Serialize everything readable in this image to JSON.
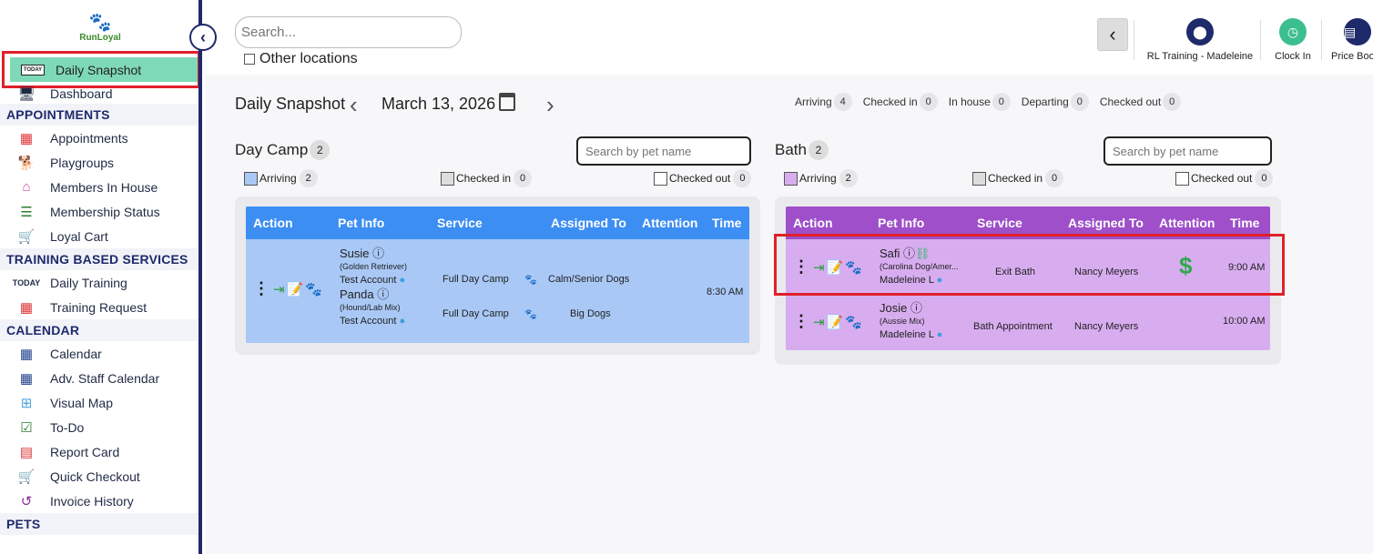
{
  "brand": {
    "name": "RunLoyal"
  },
  "sidebar": {
    "active": {
      "label": "Daily Snapshot",
      "icon": "today-icon",
      "icon_text": "TODAY"
    },
    "top_items": [
      {
        "label": "Dashboard",
        "icon": "dashboard-icon"
      }
    ],
    "sections": [
      {
        "title": "APPOINTMENTS",
        "items": [
          {
            "label": "Appointments",
            "icon": "appointments-calendar-icon"
          },
          {
            "label": "Playgroups",
            "icon": "playgroups-dog-icon"
          },
          {
            "label": "Members In House",
            "icon": "house-icon"
          },
          {
            "label": "Membership Status",
            "icon": "membership-status-icon"
          },
          {
            "label": "Loyal Cart",
            "icon": "cart-icon"
          }
        ]
      },
      {
        "title": "TRAINING BASED SERVICES",
        "items": [
          {
            "label": "Daily Training",
            "icon": "today-training-icon"
          },
          {
            "label": "Training Request",
            "icon": "training-request-icon"
          }
        ]
      },
      {
        "title": "CALENDAR",
        "items": [
          {
            "label": "Calendar",
            "icon": "calendar-icon"
          },
          {
            "label": "Adv. Staff Calendar",
            "icon": "staff-calendar-icon"
          },
          {
            "label": "Visual Map",
            "icon": "visual-map-icon"
          },
          {
            "label": "To-Do",
            "icon": "todo-icon"
          },
          {
            "label": "Report Card",
            "icon": "report-card-icon"
          },
          {
            "label": "Quick Checkout",
            "icon": "quick-checkout-icon"
          },
          {
            "label": "Invoice History",
            "icon": "invoice-history-icon"
          }
        ]
      },
      {
        "title": "PETS",
        "items": []
      }
    ]
  },
  "topbar": {
    "search_placeholder": "Search...",
    "other_locations": "Other locations",
    "location_label": "RL Training - Madeleine",
    "clock_label": "Clock In",
    "price_label": "Price Boo"
  },
  "snapshot": {
    "title": "Daily Snapshot",
    "date": "March 13, 2026",
    "counters": [
      {
        "label": "Arriving",
        "value": "4"
      },
      {
        "label": "Checked in",
        "value": "0"
      },
      {
        "label": "In house",
        "value": "0"
      },
      {
        "label": "Departing",
        "value": "0"
      },
      {
        "label": "Checked out",
        "value": "0"
      }
    ]
  },
  "daycamp": {
    "title": "Day Camp",
    "count": "2",
    "search_placeholder": "Search by pet name",
    "legend": [
      {
        "label": "Arriving",
        "value": "2"
      },
      {
        "label": "Checked in",
        "value": "0"
      },
      {
        "label": "Checked out",
        "value": "0"
      }
    ],
    "headers": [
      "Action",
      "Pet Info",
      "Service",
      "Assigned To",
      "Attention",
      "Time"
    ],
    "color": "#3d8ef3",
    "row_color": "#a9c8f6",
    "rows": [
      {
        "time": "8:30 AM",
        "pets": [
          {
            "name": "Susie",
            "breed": "(Golden Retriever)",
            "owner": "Test Account",
            "service": "Full Day Camp",
            "assigned": "Calm/Senior Dogs"
          },
          {
            "name": "Panda",
            "breed": "(Hound/Lab Mix)",
            "owner": "Test Account",
            "service": "Full Day Camp",
            "assigned": "Big Dogs"
          }
        ]
      }
    ]
  },
  "bath": {
    "title": "Bath",
    "count": "2",
    "search_placeholder": "Search by pet name",
    "legend": [
      {
        "label": "Arriving",
        "value": "2"
      },
      {
        "label": "Checked in",
        "value": "0"
      },
      {
        "label": "Checked out",
        "value": "0"
      }
    ],
    "headers": [
      "Action",
      "Pet Info",
      "Service",
      "Assigned To",
      "Attention",
      "Time"
    ],
    "color": "#9e4fc9",
    "row_color": "#d8adf0",
    "rows": [
      {
        "name": "Safi",
        "breed": "(Carolina Dog/Amer...",
        "owner": "Madeleine L",
        "service": "Exit Bath",
        "assigned": "Nancy Meyers",
        "attention": "$",
        "time": "9:00 AM"
      },
      {
        "name": "Josie",
        "breed": "(Aussie Mix)",
        "owner": "Madeleine L",
        "service": "Bath Appointment",
        "assigned": "Nancy Meyers",
        "attention": "",
        "time": "10:00 AM"
      }
    ]
  }
}
